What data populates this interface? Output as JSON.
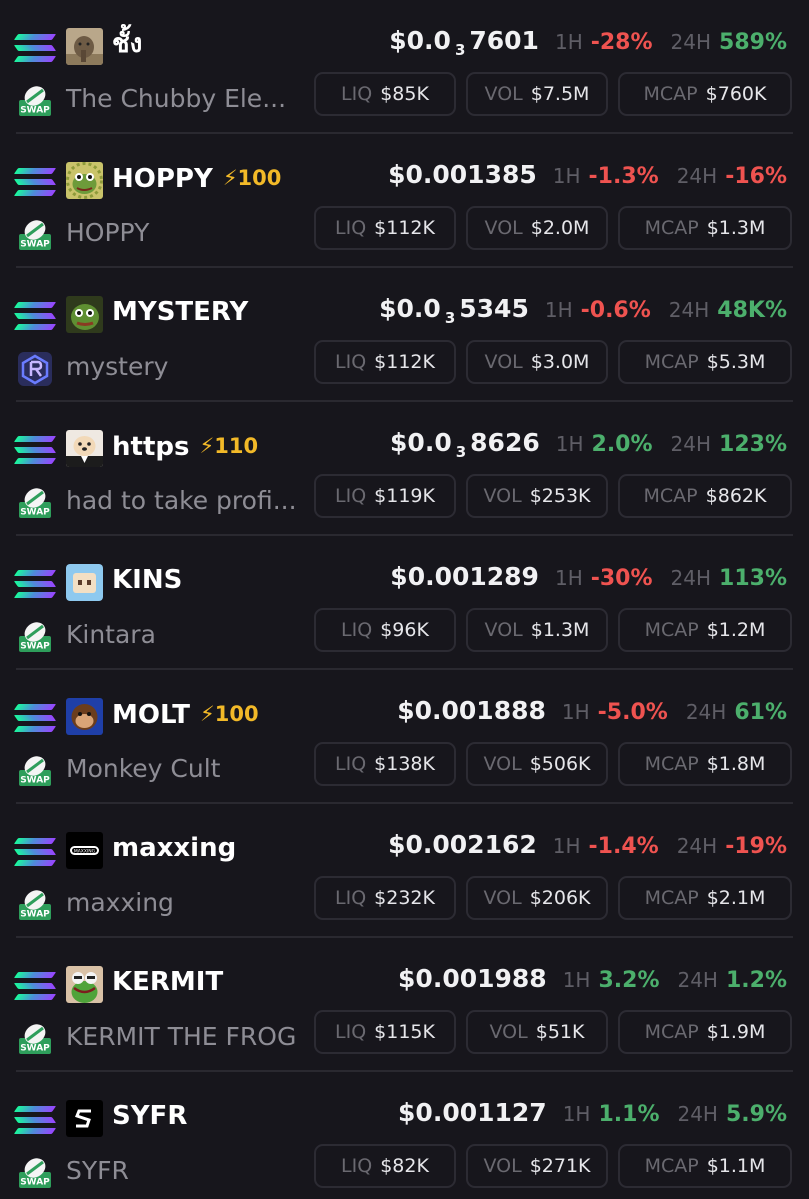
{
  "labels": {
    "h1": "1H",
    "h24": "24H",
    "liq": "LIQ",
    "vol": "VOL",
    "mcap": "MCAP",
    "swap": "SWAP"
  },
  "colors": {
    "positive": "#4caf6c",
    "negative": "#ef5350",
    "boost": "#f2b928",
    "background": "#17161c"
  },
  "tokens": [
    {
      "symbol": "ชั้ง",
      "name": "The Chubby Ele...",
      "boost": "",
      "price_prefix": "$0.0",
      "price_zeros": "3",
      "price_digits": "7601",
      "change_1h": "-28%",
      "change_1h_dir": "neg",
      "change_24h": "589%",
      "change_24h_dir": "pos",
      "liq": "$85K",
      "vol": "$7.5M",
      "mcap": "$760K",
      "avatar_icon": "elephant-avatar-icon",
      "dex_icon": "swap-icon"
    },
    {
      "symbol": "HOPPY",
      "name": "HOPPY",
      "boost": "⚡100",
      "price_prefix": "$0.001385",
      "price_zeros": "",
      "price_digits": "",
      "change_1h": "-1.3%",
      "change_1h_dir": "neg",
      "change_24h": "-16%",
      "change_24h_dir": "neg",
      "liq": "$112K",
      "vol": "$2.0M",
      "mcap": "$1.3M",
      "avatar_icon": "frog-avatar-icon",
      "dex_icon": "swap-icon"
    },
    {
      "symbol": "MYSTERY",
      "name": "mystery",
      "boost": "",
      "price_prefix": "$0.0",
      "price_zeros": "3",
      "price_digits": "5345",
      "change_1h": "-0.6%",
      "change_1h_dir": "neg",
      "change_24h": "48K%",
      "change_24h_dir": "pos",
      "liq": "$112K",
      "vol": "$3.0M",
      "mcap": "$5.3M",
      "avatar_icon": "pepe-avatar-icon",
      "dex_icon": "raydium-icon"
    },
    {
      "symbol": "https",
      "name": "had to take profi...",
      "boost": "⚡110",
      "price_prefix": "$0.0",
      "price_zeros": "3",
      "price_digits": "8626",
      "change_1h": "2.0%",
      "change_1h_dir": "pos",
      "change_24h": "123%",
      "change_24h_dir": "pos",
      "liq": "$119K",
      "vol": "$253K",
      "mcap": "$862K",
      "avatar_icon": "dog-avatar-icon",
      "dex_icon": "swap-icon"
    },
    {
      "symbol": "KINS",
      "name": "Kintara",
      "boost": "",
      "price_prefix": "$0.001289",
      "price_zeros": "",
      "price_digits": "",
      "change_1h": "-30%",
      "change_1h_dir": "neg",
      "change_24h": "113%",
      "change_24h_dir": "pos",
      "liq": "$96K",
      "vol": "$1.3M",
      "mcap": "$1.2M",
      "avatar_icon": "pixel-face-avatar-icon",
      "dex_icon": "swap-icon"
    },
    {
      "symbol": "MOLT",
      "name": "Monkey Cult",
      "boost": "⚡100",
      "price_prefix": "$0.001888",
      "price_zeros": "",
      "price_digits": "",
      "change_1h": "-5.0%",
      "change_1h_dir": "neg",
      "change_24h": "61%",
      "change_24h_dir": "pos",
      "liq": "$138K",
      "vol": "$506K",
      "mcap": "$1.8M",
      "avatar_icon": "monkey-avatar-icon",
      "dex_icon": "swap-icon"
    },
    {
      "symbol": "maxxing",
      "name": "maxxing",
      "boost": "",
      "price_prefix": "$0.002162",
      "price_zeros": "",
      "price_digits": "",
      "change_1h": "-1.4%",
      "change_1h_dir": "neg",
      "change_24h": "-19%",
      "change_24h_dir": "neg",
      "liq": "$232K",
      "vol": "$206K",
      "mcap": "$2.1M",
      "avatar_icon": "maxxing-logo-avatar-icon",
      "dex_icon": "swap-icon"
    },
    {
      "symbol": "KERMIT",
      "name": "KERMIT THE FROG",
      "boost": "",
      "price_prefix": "$0.001988",
      "price_zeros": "",
      "price_digits": "",
      "change_1h": "3.2%",
      "change_1h_dir": "pos",
      "change_24h": "1.2%",
      "change_24h_dir": "pos",
      "liq": "$115K",
      "vol": "$51K",
      "mcap": "$1.9M",
      "avatar_icon": "kermit-avatar-icon",
      "dex_icon": "swap-icon"
    },
    {
      "symbol": "SYFR",
      "name": "SYFR",
      "boost": "",
      "price_prefix": "$0.001127",
      "price_zeros": "",
      "price_digits": "",
      "change_1h": "1.1%",
      "change_1h_dir": "pos",
      "change_24h": "5.9%",
      "change_24h_dir": "pos",
      "liq": "$82K",
      "vol": "$271K",
      "mcap": "$1.1M",
      "avatar_icon": "syfr-logo-avatar-icon",
      "dex_icon": "swap-icon"
    }
  ]
}
